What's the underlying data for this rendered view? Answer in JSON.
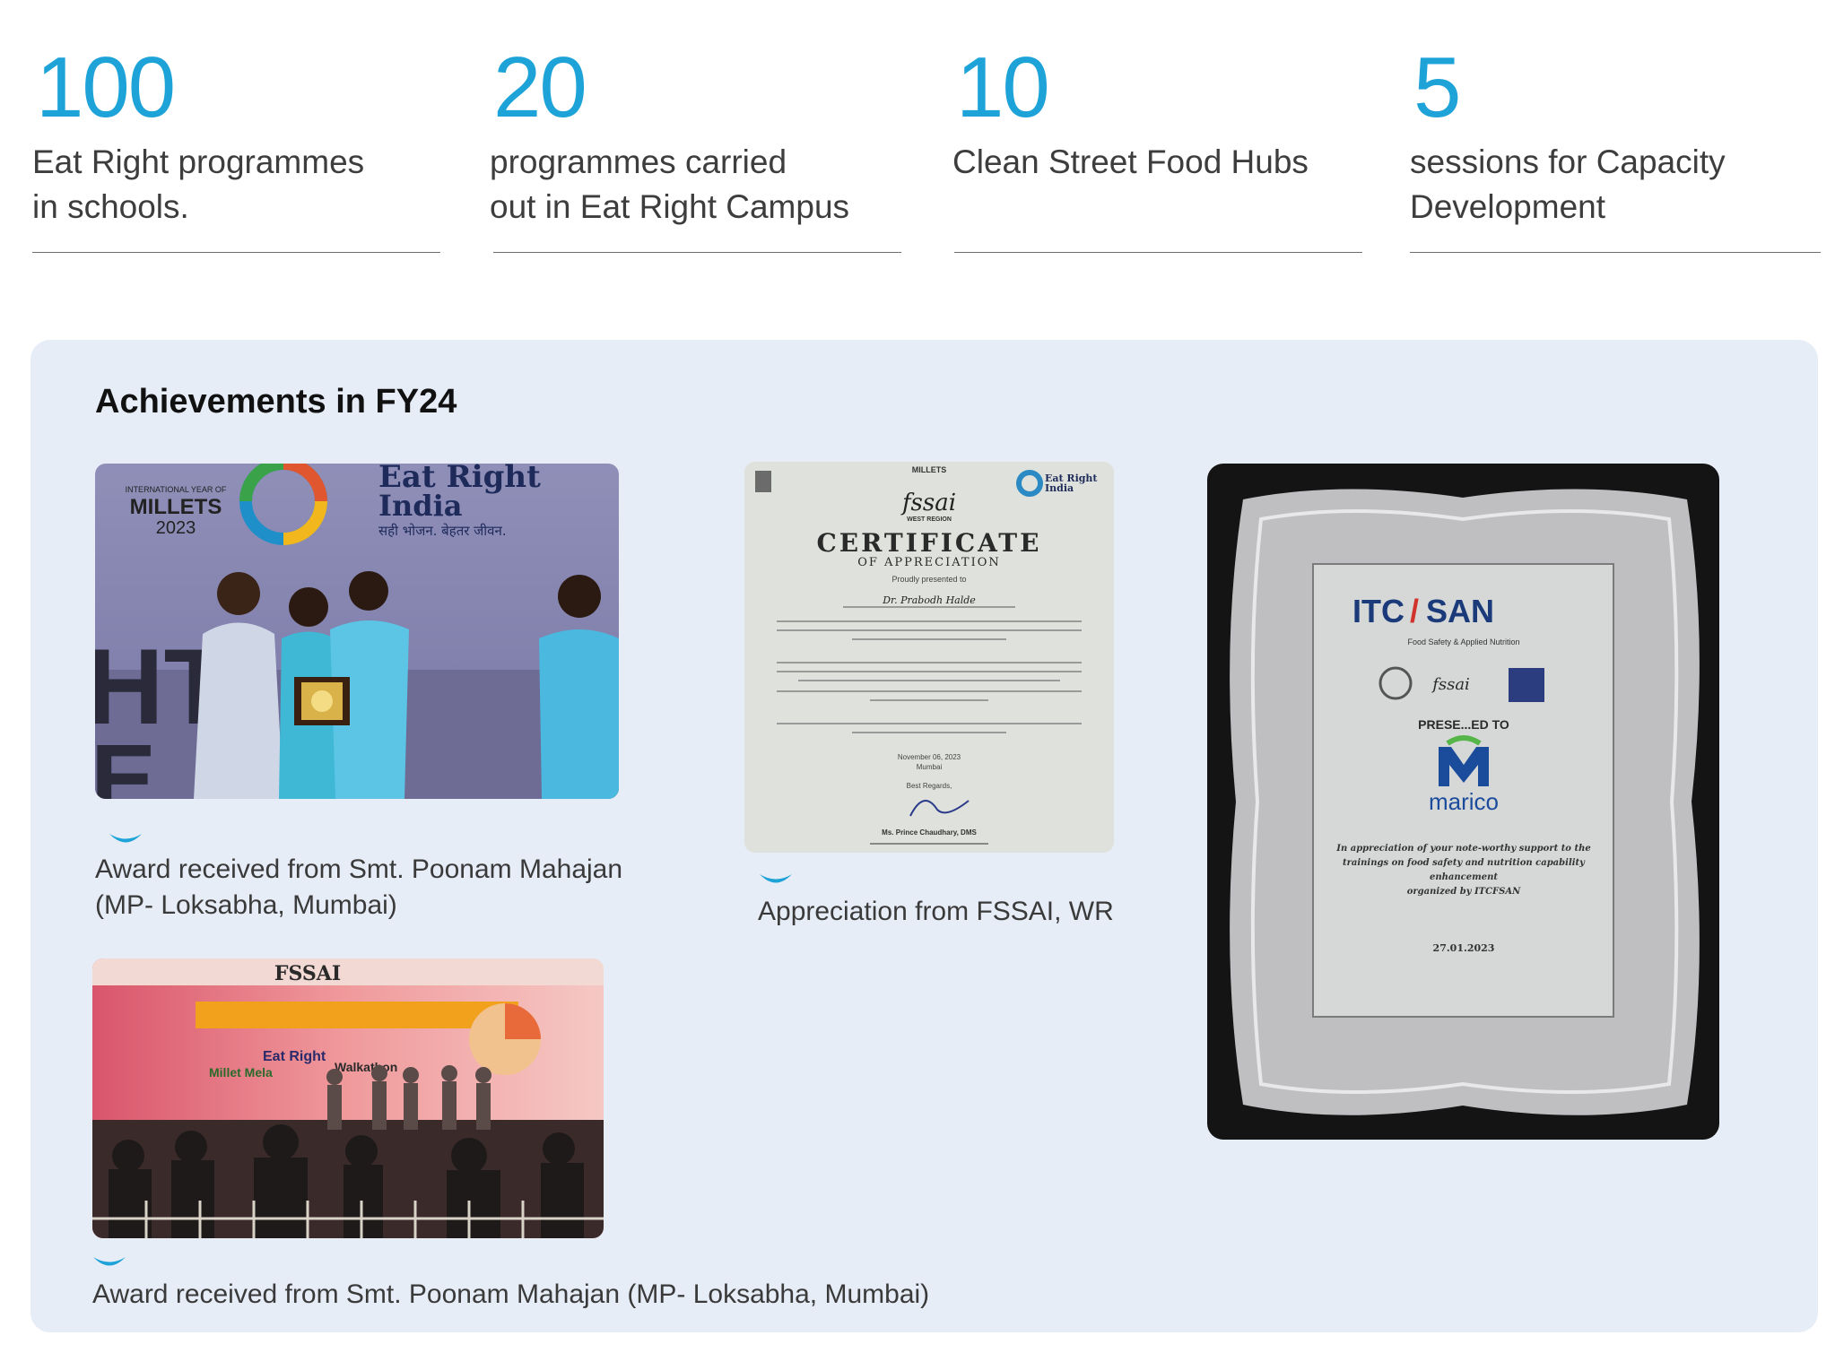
{
  "stats": [
    {
      "number": "100",
      "line1": "Eat Right programmes",
      "line2": "in schools."
    },
    {
      "number": "20",
      "line1": "programmes carried",
      "line2": "out in Eat Right Campus"
    },
    {
      "number": "10",
      "line1": "Clean Street Food Hubs",
      "line2": ""
    },
    {
      "number": "5",
      "line1": "sessions for Capacity",
      "line2": "Development"
    }
  ],
  "achievements": {
    "title": "Achievements in FY24",
    "photo1": {
      "caption_line1": "Award received from Smt. Poonam Mahajan",
      "caption_line2": "(MP- Loksabha, Mumbai)",
      "banner_left_1": "INTERNATIONAL YEAR OF",
      "banner_left_2": "MILLETS",
      "banner_left_3": "2023",
      "banner_right_1": "Eat Right",
      "banner_right_2": "India",
      "banner_right_3": "सही भोजन. बेहतर जीवन."
    },
    "photo2": {
      "caption": "Appreciation from FSSAI, WR",
      "header": "MILLETS",
      "brand": "fssai",
      "region": "WEST REGION",
      "cert_title": "CERTIFICATE",
      "cert_subtitle": "OF APPRECIATION",
      "presented": "Proudly presented to",
      "recipient": "Dr. Prabodh Halde",
      "date_line": "November 06, 2023",
      "city": "Mumbai",
      "regards": "Best Regards,",
      "signatory": "Ms. Prince Chaudhary, DMS",
      "badge_1": "Eat Right",
      "badge_2": "India"
    },
    "photo3": {
      "caption": "Award received from Smt. Poonam Mahajan (MP- Loksabha, Mumbai)",
      "banner_brand": "FSSAI",
      "stage_text_1": "Eat Right",
      "stage_text_2": "Millet Mela",
      "stage_text_3": "Walkathon"
    },
    "plaque": {
      "org_left": "ITC",
      "org_right": "SAN",
      "org_sub": "Food Safety & Applied Nutrition",
      "brand": "fssai",
      "presented": "PRESE...ED TO",
      "company": "marico",
      "appreciation_1": "In appreciation of your note-worthy support to the",
      "appreciation_2": "trainings on food safety and nutrition capability",
      "appreciation_3": "enhancement",
      "appreciation_4": "organized by ITCFSAN",
      "date": "27.01.2023"
    }
  },
  "colors": {
    "accent": "#1ea3d8",
    "panel": "#e6edf7",
    "rule": "#6d6d6d"
  }
}
